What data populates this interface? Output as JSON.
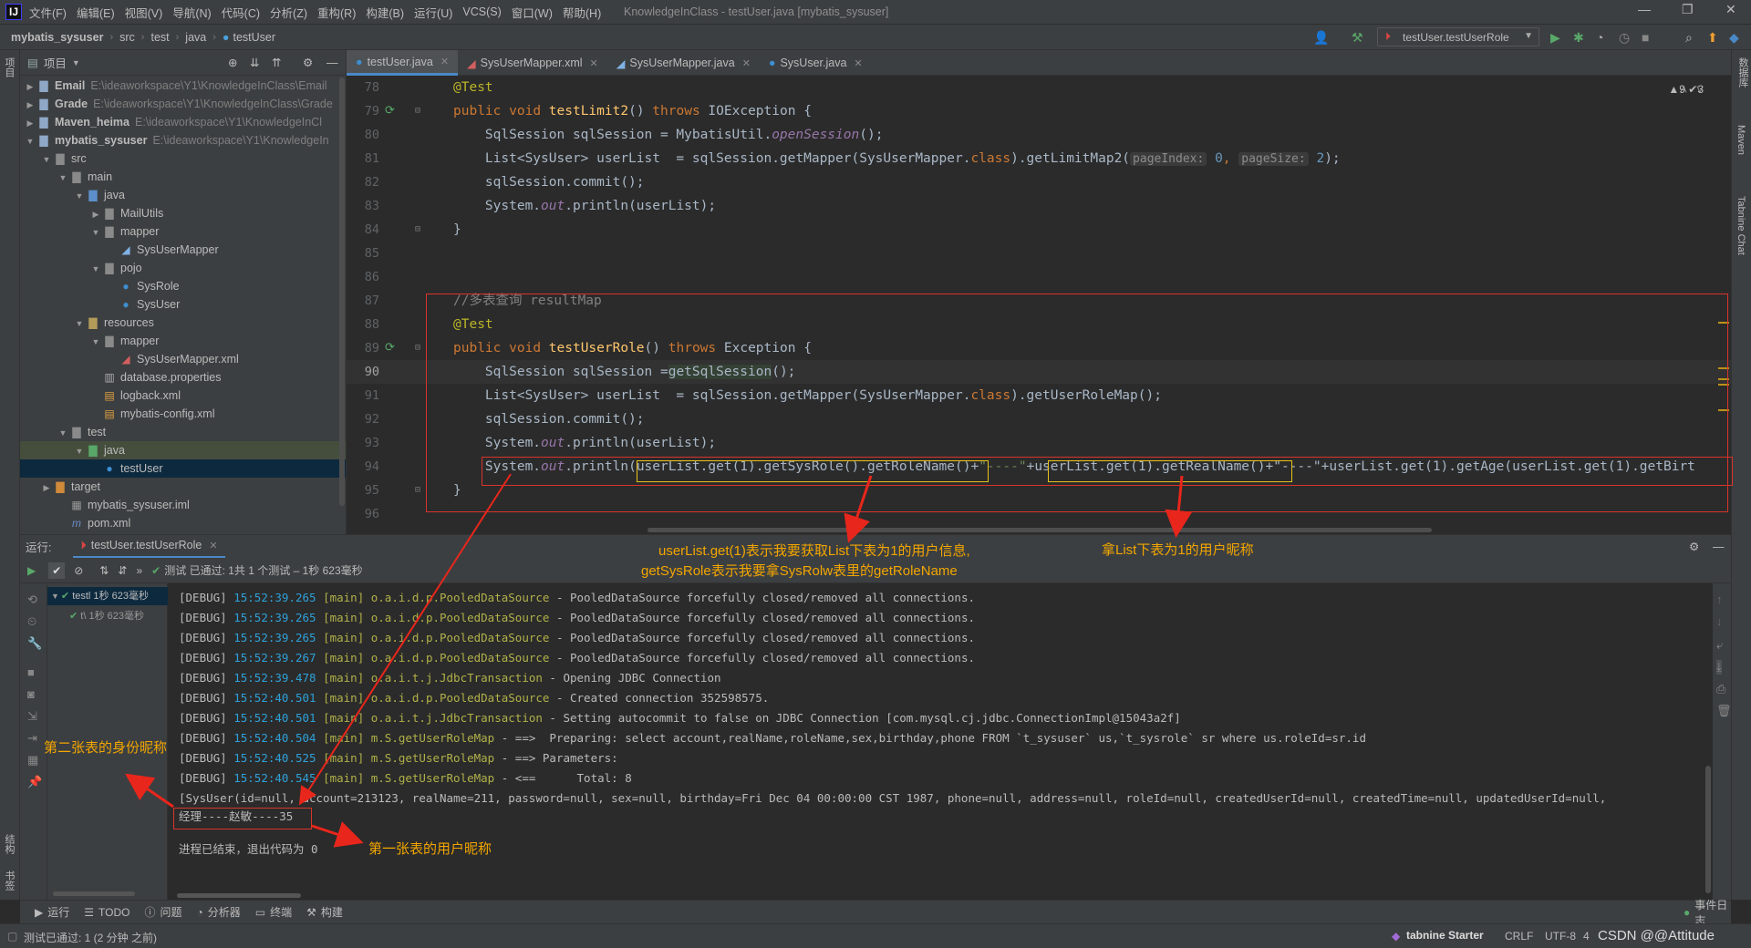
{
  "menubar": {
    "items": [
      "文件(F)",
      "编辑(E)",
      "视图(V)",
      "导航(N)",
      "代码(C)",
      "分析(Z)",
      "重构(R)",
      "构建(B)",
      "运行(U)",
      "VCS(S)",
      "窗口(W)",
      "帮助(H)"
    ],
    "title": "KnowledgeInClass - testUser.java [mybatis_sysuser]"
  },
  "breadcrumb": [
    "mybatis_sysuser",
    "src",
    "test",
    "java",
    "testUser"
  ],
  "run_config": "testUser.testUserRole",
  "left_strip": {
    "project": "项目",
    "bookmarks": "书签",
    "structure": "结构"
  },
  "right_strip": {
    "database": "数据库",
    "maven": "Maven",
    "tabnine": "Tabnine Chat"
  },
  "project_panel": {
    "title": "项目",
    "rows": [
      {
        "name": "Email",
        "path": "E:\\ideaworkspace\\Y1\\KnowledgeInClass\\Email"
      },
      {
        "name": "Grade",
        "path": "E:\\ideaworkspace\\Y1\\KnowledgeInClass\\Grade"
      },
      {
        "name": "Maven_heima",
        "path": "E:\\ideaworkspace\\Y1\\KnowledgeInCl"
      },
      {
        "name": "mybatis_sysuser",
        "path": "E:\\ideaworkspace\\Y1\\KnowledgeIn"
      },
      {
        "name": "src"
      },
      {
        "name": "main"
      },
      {
        "name": "java"
      },
      {
        "name": "MailUtils"
      },
      {
        "name": "mapper"
      },
      {
        "name": "SysUserMapper"
      },
      {
        "name": "pojo"
      },
      {
        "name": "SysRole"
      },
      {
        "name": "SysUser"
      },
      {
        "name": "resources"
      },
      {
        "name": "mapper"
      },
      {
        "name": "SysUserMapper.xml"
      },
      {
        "name": "database.properties"
      },
      {
        "name": "logback.xml"
      },
      {
        "name": "mybatis-config.xml"
      },
      {
        "name": "test"
      },
      {
        "name": "java"
      },
      {
        "name": "testUser"
      },
      {
        "name": "target"
      },
      {
        "name": "mybatis_sysuser.iml"
      },
      {
        "name": "pom.xml"
      }
    ]
  },
  "editor_tabs": [
    "testUser.java",
    "SysUserMapper.xml",
    "SysUserMapper.java",
    "SysUser.java"
  ],
  "editor": {
    "warnings": "▲9 ✔3",
    "line_numbers": [
      "78",
      "79",
      "80",
      "81",
      "82",
      "83",
      "84",
      "85",
      "86",
      "87",
      "88",
      "89",
      "90",
      "91",
      "92",
      "93",
      "94",
      "95",
      "96"
    ],
    "t": {
      "test": "@Test",
      "pub": "public",
      "void": "void",
      "m1": "testLimit2",
      "throws": "throws",
      "ioe": "IOException",
      "ob": "{",
      "cb": "}",
      "l80a": "SqlSession sqlSession = MybatisUtil.",
      "openSession": "openSession",
      "l80b": "();",
      "l81a": "List<SysUser> userList  = sqlSession.getMapper(SysUserMapper.",
      "cls": "class",
      "l81b": ").getLimitMap2(",
      "hint1": "pageIndex:",
      "v0": "0",
      ",": ",",
      "hint2": "pageSize:",
      "v2": "2",
      "l81c": ");",
      "commit": "sqlSession.commit();",
      "sys": "System.",
      "out": "out",
      "println": ".println(userList);",
      "comment": "//多表查询 resultMap",
      "m2": "testUserRole",
      "exc": "Exception",
      "l90a": "SqlSession sqlSession =",
      "getSql": "getSqlSession",
      "l90b": "();",
      "l91b": ").getUserRoleMap();",
      "l94a": ".println(",
      "l94b": "userList.get(1).getSysRole().getRoleName()",
      "plus1": "+",
      "sep": "\"----\"",
      "plus2": "+",
      "l94c": "userList.get(1).getRealName()",
      "l94d": "+\"----\"+userList.get(1).getAge(userList.get(1).getBirt"
    }
  },
  "run_panel": {
    "label": "运行:",
    "tab": "testUser.testUserRole",
    "status": "测试 已通过: 1共 1 个测试 – 1秒 623毫秒",
    "tree_root": "testl 1秒 623毫秒",
    "tree_child": "t\\ 1秒 623毫秒"
  },
  "console": [
    {
      "lvl": "[DEBUG]",
      "ts": "15:52:39.265",
      "th": "[main]",
      "logger": "o.a.i.d.p.PooledDataSource",
      "msg": " - PooledDataSource forcefully closed/removed all connections."
    },
    {
      "lvl": "[DEBUG]",
      "ts": "15:52:39.265",
      "th": "[main]",
      "logger": "o.a.i.d.p.PooledDataSource",
      "msg": " - PooledDataSource forcefully closed/removed all connections."
    },
    {
      "lvl": "[DEBUG]",
      "ts": "15:52:39.265",
      "th": "[main]",
      "logger": "o.a.i.d.p.PooledDataSource",
      "msg": " - PooledDataSource forcefully closed/removed all connections."
    },
    {
      "lvl": "[DEBUG]",
      "ts": "15:52:39.267",
      "th": "[main]",
      "logger": "o.a.i.d.p.PooledDataSource",
      "msg": " - PooledDataSource forcefully closed/removed all connections."
    },
    {
      "lvl": "[DEBUG]",
      "ts": "15:52:39.478",
      "th": "[main]",
      "logger": "o.a.i.t.j.JdbcTransaction",
      "msg": " - Opening JDBC Connection"
    },
    {
      "lvl": "[DEBUG]",
      "ts": "15:52:40.501",
      "th": "[main]",
      "logger": "o.a.i.d.p.PooledDataSource",
      "msg": " - Created connection 352598575."
    },
    {
      "lvl": "[DEBUG]",
      "ts": "15:52:40.501",
      "th": "[main]",
      "logger": "o.a.i.t.j.JdbcTransaction",
      "msg": " - Setting autocommit to false on JDBC Connection [com.mysql.cj.jdbc.ConnectionImpl@15043a2f]"
    },
    {
      "lvl": "[DEBUG]",
      "ts": "15:52:40.504",
      "th": "[main]",
      "logger": "m.S.getUserRoleMap",
      "msg": " - ==>  Preparing: select account,realName,roleName,sex,birthday,phone FROM `t_sysuser` us,`t_sysrole` sr where us.roleId=sr.id"
    },
    {
      "lvl": "[DEBUG]",
      "ts": "15:52:40.525",
      "th": "[main]",
      "logger": "m.S.getUserRoleMap",
      "msg": " - ==> Parameters: "
    },
    {
      "lvl": "[DEBUG]",
      "ts": "15:52:40.545",
      "th": "[main]",
      "logger": "m.S.getUserRoleMap",
      "msg": " - <==      Total: 8"
    }
  ],
  "console_result": "[SysUser(id=null, account=213123, realName=211, password=null, sex=null, birthday=Fri Dec 04 00:00:00 CST 1987, phone=null, address=null, roleId=null, createdUserId=null, createdTime=null, updatedUserId=null,",
  "console_output": "经理----赵敏----35",
  "console_exit": "进程已结束，退出代码为 0",
  "bottom_tabs": [
    "运行",
    "TODO",
    "问题",
    "分析器",
    "终端",
    "构建"
  ],
  "event_log": "事件日志",
  "status": {
    "left": "测试已通过: 1 (2 分钟 之前)",
    "tabnine": "tabnine Starter",
    "crlf": "CRLF",
    "enc": "UTF-8",
    "indent": "4",
    "watermark": "CSDN @@Attitude"
  },
  "annotations": {
    "a1_line1": "userList.get(1)表示我要获取List下表为1的用户信息,",
    "a1_line2": "getSysRole表示我要拿SysRolw表里的getRoleName",
    "a2": "拿List下表为1的用户昵称",
    "a3": "第二张表的身份昵称",
    "a4": "第一张表的用户昵称"
  },
  "colors": {
    "accent": "#4a88c7",
    "annotation": "#f3a600",
    "arrow": "#e8261b",
    "keyword": "#cc7832"
  }
}
